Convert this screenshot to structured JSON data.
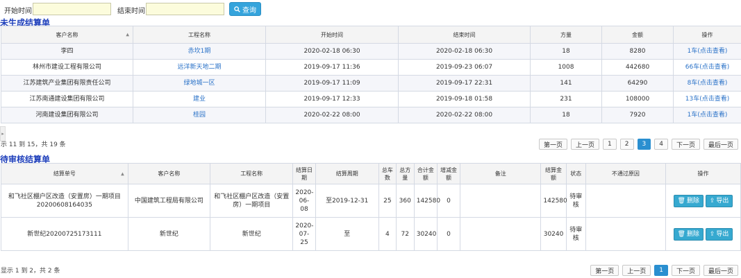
{
  "filter": {
    "start_label": "开始时间:",
    "end_label": "结束时间:",
    "start_value": "",
    "end_value": "",
    "query_label": "查询",
    "query_icon": "search-icon"
  },
  "unsettled": {
    "title": "未生成结算单",
    "columns": [
      "客户名称",
      "工程名称",
      "开始时间",
      "结束时间",
      "方量",
      "金额",
      "操作"
    ],
    "rows": [
      {
        "customer": "李四",
        "project": "赤坎1期",
        "start": "2020-02-18 06:30",
        "end": "2020-02-18 06:30",
        "volume": "18",
        "amount": "8280",
        "action": "1车(点击查看)"
      },
      {
        "customer": "林州市建设工程有限公司",
        "project": "远洋新天地二期",
        "start": "2019-09-17 11:36",
        "end": "2019-09-23 06:07",
        "volume": "1008",
        "amount": "442680",
        "action": "66车(点击查看)"
      },
      {
        "customer": "江苏建筑产业集团有限责任公司",
        "project": "绿地城一区",
        "start": "2019-09-17 11:09",
        "end": "2019-09-17 22:31",
        "volume": "141",
        "amount": "64290",
        "action": "8车(点击查看)"
      },
      {
        "customer": "江苏南通建设集团有限公司",
        "project": "建业",
        "start": "2019-09-17 12:33",
        "end": "2019-09-18 01:58",
        "volume": "231",
        "amount": "108000",
        "action": "13车(点击查看)"
      },
      {
        "customer": "河南建设集团有限公司",
        "project": "桂园",
        "start": "2020-02-22 08:00",
        "end": "2020-02-22 08:00",
        "volume": "18",
        "amount": "7920",
        "action": "1车(点击查看)"
      }
    ],
    "info": "示 11 到 15，共 19 条",
    "pager": {
      "first": "第一页",
      "prev": "上一页",
      "next": "下一页",
      "last": "最后一页",
      "pages": [
        "1",
        "2",
        "3",
        "4"
      ],
      "active_page": "3"
    }
  },
  "pending": {
    "title": "待审核结算单",
    "columns": [
      "结算单号",
      "客户名称",
      "工程名称",
      "结算日期",
      "结算周期",
      "总车数",
      "总方量",
      "合计金额",
      "增减金额",
      "备注",
      "结算金额",
      "状态",
      "不通过原因",
      "操作"
    ],
    "rows": [
      {
        "no": "和飞社区棚户区改造（安置房）一期项目20200608164035",
        "customer": "中国建筑工程局有限公司",
        "project": "和飞社区棚户区改造（安置房）一期项目",
        "date": "2020-06-08",
        "period": "至2019-12-31",
        "trucks": "25",
        "volume": "360",
        "total": "142580",
        "adjust": "0",
        "remark": "",
        "settle": "142580",
        "status": "待审核",
        "reason": "",
        "delete": "删除",
        "export": "导出"
      },
      {
        "no": "新世纪20200725173111",
        "customer": "新世纪",
        "project": "新世纪",
        "date": "2020-07-25",
        "period": "至",
        "trucks": "4",
        "volume": "72",
        "total": "30240",
        "adjust": "0",
        "remark": "",
        "settle": "30240",
        "status": "待审核",
        "reason": "",
        "delete": "删除",
        "export": "导出"
      }
    ],
    "info": "显示 1 到 2，共 2 条",
    "pager": {
      "first": "第一页",
      "prev": "上一页",
      "next": "下一页",
      "last": "最后一页",
      "pages": [
        "1"
      ],
      "active_page": "1"
    }
  },
  "colors": {
    "accent": "#35a4dc",
    "title": "#1e3fbb",
    "link": "#2a72c8",
    "active_page": "#2a8fd0"
  }
}
